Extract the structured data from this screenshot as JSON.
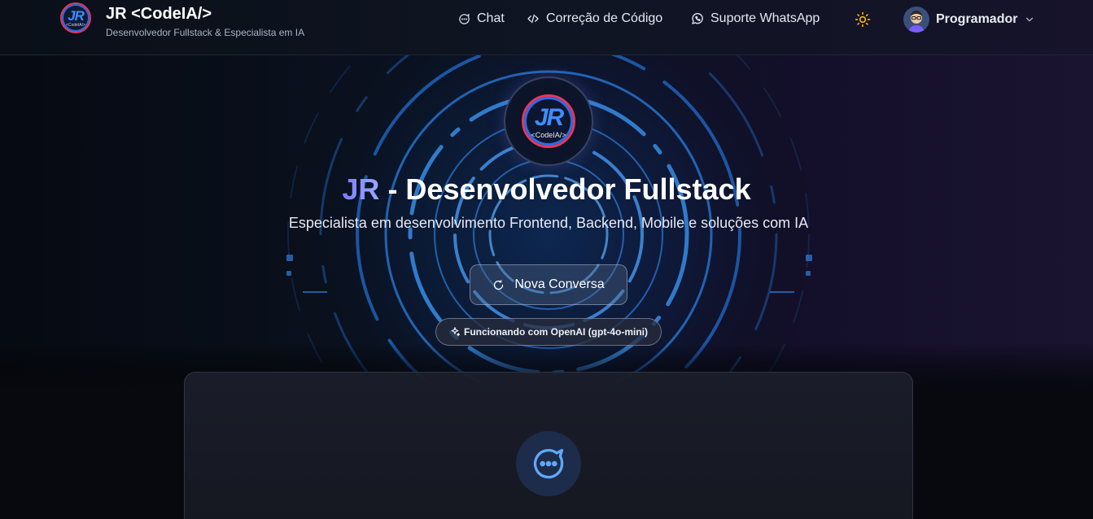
{
  "header": {
    "logo_text": "JR",
    "logo_sub": "<CodeIA/>",
    "title": "JR <CodeIA/>",
    "subtitle": "Desenvolvedor Fullstack & Especialista em IA",
    "nav": [
      {
        "label": "Chat",
        "icon": "chat-bubble-icon"
      },
      {
        "label": "Correção de Código",
        "icon": "code-icon"
      },
      {
        "label": "Suporte WhatsApp",
        "icon": "whatsapp-icon"
      }
    ],
    "theme_icon": "sun-icon",
    "user": {
      "name": "Programador",
      "avatar": "avatar-icon"
    }
  },
  "hero": {
    "logo_text": "JR",
    "logo_sub": "<CodeIA/>",
    "title_accent": "JR",
    "title_rest": " - Desenvolvedor Fullstack",
    "description": "Especialista em desenvolvimento Frontend, Backend, Mobile e soluções com IA",
    "new_chat_label": "Nova Conversa",
    "badge": "Funcionando com OpenAI (gpt-4o-mini)"
  },
  "colors": {
    "accent": "#7b7dff",
    "sun": "#f5b400",
    "logo_red": "#e8355d",
    "logo_blue": "#3d8cff",
    "chat_icon": "#5fa8ff"
  }
}
